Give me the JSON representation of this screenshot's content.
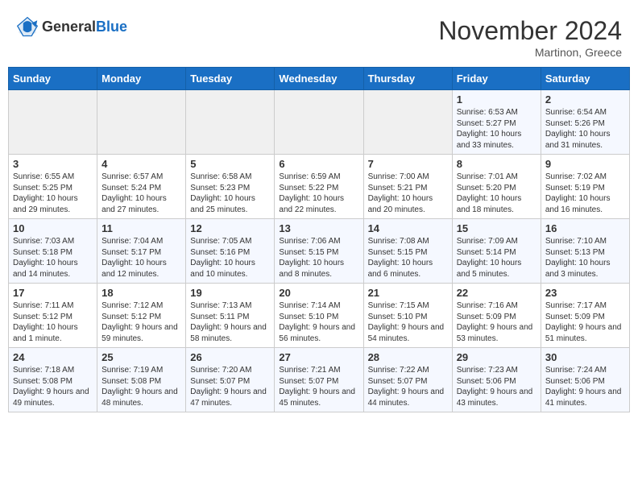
{
  "header": {
    "logo_line1": "General",
    "logo_line2": "Blue",
    "month": "November 2024",
    "location": "Martinon, Greece"
  },
  "weekdays": [
    "Sunday",
    "Monday",
    "Tuesday",
    "Wednesday",
    "Thursday",
    "Friday",
    "Saturday"
  ],
  "weeks": [
    [
      {
        "day": "",
        "info": ""
      },
      {
        "day": "",
        "info": ""
      },
      {
        "day": "",
        "info": ""
      },
      {
        "day": "",
        "info": ""
      },
      {
        "day": "",
        "info": ""
      },
      {
        "day": "1",
        "info": "Sunrise: 6:53 AM\nSunset: 5:27 PM\nDaylight: 10 hours and 33 minutes."
      },
      {
        "day": "2",
        "info": "Sunrise: 6:54 AM\nSunset: 5:26 PM\nDaylight: 10 hours and 31 minutes."
      }
    ],
    [
      {
        "day": "3",
        "info": "Sunrise: 6:55 AM\nSunset: 5:25 PM\nDaylight: 10 hours and 29 minutes."
      },
      {
        "day": "4",
        "info": "Sunrise: 6:57 AM\nSunset: 5:24 PM\nDaylight: 10 hours and 27 minutes."
      },
      {
        "day": "5",
        "info": "Sunrise: 6:58 AM\nSunset: 5:23 PM\nDaylight: 10 hours and 25 minutes."
      },
      {
        "day": "6",
        "info": "Sunrise: 6:59 AM\nSunset: 5:22 PM\nDaylight: 10 hours and 22 minutes."
      },
      {
        "day": "7",
        "info": "Sunrise: 7:00 AM\nSunset: 5:21 PM\nDaylight: 10 hours and 20 minutes."
      },
      {
        "day": "8",
        "info": "Sunrise: 7:01 AM\nSunset: 5:20 PM\nDaylight: 10 hours and 18 minutes."
      },
      {
        "day": "9",
        "info": "Sunrise: 7:02 AM\nSunset: 5:19 PM\nDaylight: 10 hours and 16 minutes."
      }
    ],
    [
      {
        "day": "10",
        "info": "Sunrise: 7:03 AM\nSunset: 5:18 PM\nDaylight: 10 hours and 14 minutes."
      },
      {
        "day": "11",
        "info": "Sunrise: 7:04 AM\nSunset: 5:17 PM\nDaylight: 10 hours and 12 minutes."
      },
      {
        "day": "12",
        "info": "Sunrise: 7:05 AM\nSunset: 5:16 PM\nDaylight: 10 hours and 10 minutes."
      },
      {
        "day": "13",
        "info": "Sunrise: 7:06 AM\nSunset: 5:15 PM\nDaylight: 10 hours and 8 minutes."
      },
      {
        "day": "14",
        "info": "Sunrise: 7:08 AM\nSunset: 5:15 PM\nDaylight: 10 hours and 6 minutes."
      },
      {
        "day": "15",
        "info": "Sunrise: 7:09 AM\nSunset: 5:14 PM\nDaylight: 10 hours and 5 minutes."
      },
      {
        "day": "16",
        "info": "Sunrise: 7:10 AM\nSunset: 5:13 PM\nDaylight: 10 hours and 3 minutes."
      }
    ],
    [
      {
        "day": "17",
        "info": "Sunrise: 7:11 AM\nSunset: 5:12 PM\nDaylight: 10 hours and 1 minute."
      },
      {
        "day": "18",
        "info": "Sunrise: 7:12 AM\nSunset: 5:12 PM\nDaylight: 9 hours and 59 minutes."
      },
      {
        "day": "19",
        "info": "Sunrise: 7:13 AM\nSunset: 5:11 PM\nDaylight: 9 hours and 58 minutes."
      },
      {
        "day": "20",
        "info": "Sunrise: 7:14 AM\nSunset: 5:10 PM\nDaylight: 9 hours and 56 minutes."
      },
      {
        "day": "21",
        "info": "Sunrise: 7:15 AM\nSunset: 5:10 PM\nDaylight: 9 hours and 54 minutes."
      },
      {
        "day": "22",
        "info": "Sunrise: 7:16 AM\nSunset: 5:09 PM\nDaylight: 9 hours and 53 minutes."
      },
      {
        "day": "23",
        "info": "Sunrise: 7:17 AM\nSunset: 5:09 PM\nDaylight: 9 hours and 51 minutes."
      }
    ],
    [
      {
        "day": "24",
        "info": "Sunrise: 7:18 AM\nSunset: 5:08 PM\nDaylight: 9 hours and 49 minutes."
      },
      {
        "day": "25",
        "info": "Sunrise: 7:19 AM\nSunset: 5:08 PM\nDaylight: 9 hours and 48 minutes."
      },
      {
        "day": "26",
        "info": "Sunrise: 7:20 AM\nSunset: 5:07 PM\nDaylight: 9 hours and 47 minutes."
      },
      {
        "day": "27",
        "info": "Sunrise: 7:21 AM\nSunset: 5:07 PM\nDaylight: 9 hours and 45 minutes."
      },
      {
        "day": "28",
        "info": "Sunrise: 7:22 AM\nSunset: 5:07 PM\nDaylight: 9 hours and 44 minutes."
      },
      {
        "day": "29",
        "info": "Sunrise: 7:23 AM\nSunset: 5:06 PM\nDaylight: 9 hours and 43 minutes."
      },
      {
        "day": "30",
        "info": "Sunrise: 7:24 AM\nSunset: 5:06 PM\nDaylight: 9 hours and 41 minutes."
      }
    ]
  ]
}
